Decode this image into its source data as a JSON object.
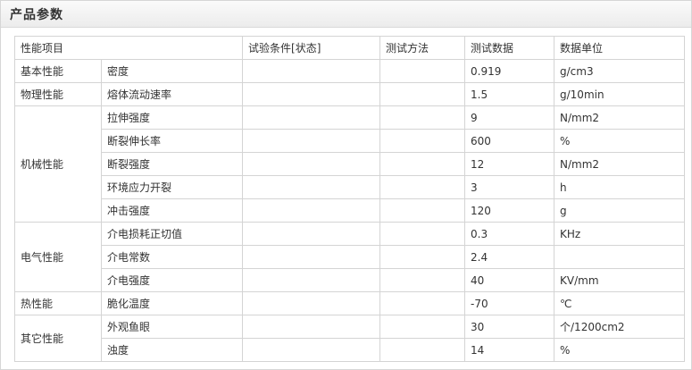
{
  "header": {
    "title": "产品参数"
  },
  "table": {
    "columns": [
      "性能项目",
      "试验条件[状态]",
      "测试方法",
      "测试数据",
      "数据单位"
    ],
    "groups": [
      {
        "category": "基本性能",
        "rows": [
          {
            "item": "密度",
            "condition": "",
            "method": "",
            "value": "0.919",
            "unit": "g/cm3"
          }
        ]
      },
      {
        "category": "物理性能",
        "rows": [
          {
            "item": "熔体流动速率",
            "condition": "",
            "method": "",
            "value": "1.5",
            "unit": "g/10min"
          }
        ]
      },
      {
        "category": "机械性能",
        "rows": [
          {
            "item": "拉伸强度",
            "condition": "",
            "method": "",
            "value": "9",
            "unit": "N/mm2"
          },
          {
            "item": "断裂伸长率",
            "condition": "",
            "method": "",
            "value": "600",
            "unit": "%"
          },
          {
            "item": "断裂强度",
            "condition": "",
            "method": "",
            "value": "12",
            "unit": "N/mm2"
          },
          {
            "item": "环境应力开裂",
            "condition": "",
            "method": "",
            "value": "3",
            "unit": "h"
          },
          {
            "item": "冲击强度",
            "condition": "",
            "method": "",
            "value": "120",
            "unit": "g"
          }
        ]
      },
      {
        "category": "电气性能",
        "rows": [
          {
            "item": "介电损耗正切值",
            "condition": "",
            "method": "",
            "value": "0.3",
            "unit": "KHz"
          },
          {
            "item": "介电常数",
            "condition": "",
            "method": "",
            "value": "2.4",
            "unit": ""
          },
          {
            "item": "介电强度",
            "condition": "",
            "method": "",
            "value": "40",
            "unit": "KV/mm"
          }
        ]
      },
      {
        "category": "热性能",
        "rows": [
          {
            "item": "脆化温度",
            "condition": "",
            "method": "",
            "value": "-70",
            "unit": "℃"
          }
        ]
      },
      {
        "category": "其它性能",
        "rows": [
          {
            "item": "外观鱼眼",
            "condition": "",
            "method": "",
            "value": "30",
            "unit": "个/1200cm2"
          },
          {
            "item": "浊度",
            "condition": "",
            "method": "",
            "value": "14",
            "unit": "%"
          }
        ]
      }
    ]
  }
}
